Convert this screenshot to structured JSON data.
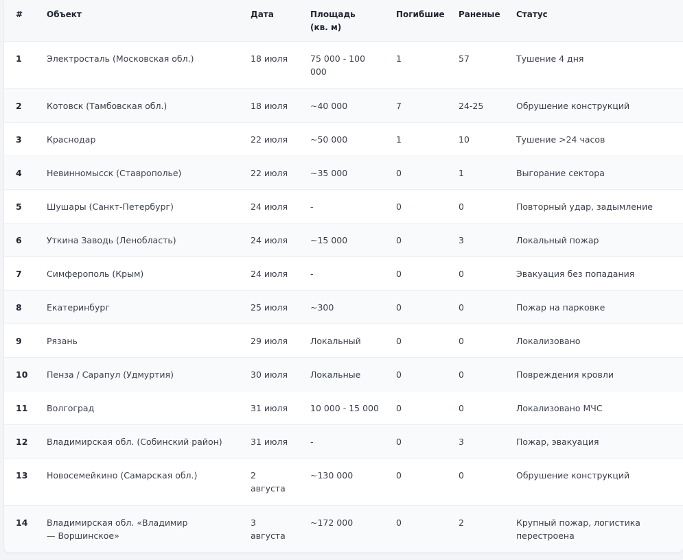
{
  "table": {
    "headers": {
      "num": "#",
      "object": "Объект",
      "date": "Дата",
      "area": "Площадь (кв. м)",
      "dead": "Погибшие",
      "injured": "Раненые",
      "status": "Статус"
    },
    "rows": [
      {
        "num": "1",
        "object": "Электросталь (Московская обл.)",
        "date": "18 июля",
        "area": "75 000 - 100 000",
        "dead": "1",
        "injured": "57",
        "status": "Тушение 4 дня"
      },
      {
        "num": "2",
        "object": "Котовск (Тамбовская обл.)",
        "date": "18 июля",
        "area": "~40 000",
        "dead": "7",
        "injured": "24-25",
        "status": "Обрушение конструкций"
      },
      {
        "num": "3",
        "object": "Краснодар",
        "date": "22 июля",
        "area": "~50 000",
        "dead": "1",
        "injured": "10",
        "status": "Тушение >24 часов"
      },
      {
        "num": "4",
        "object": "Невинномысск (Ставрополье)",
        "date": "22 июля",
        "area": "~35 000",
        "dead": "0",
        "injured": "1",
        "status": "Выгорание сектора"
      },
      {
        "num": "5",
        "object": "Шушары (Санкт-Петербург)",
        "date": "24 июля",
        "area": "-",
        "dead": "0",
        "injured": "0",
        "status": "Повторный удар, задымление"
      },
      {
        "num": "6",
        "object": "Уткина Заводь (Ленобласть)",
        "date": "24 июля",
        "area": "~15 000",
        "dead": "0",
        "injured": "3",
        "status": "Локальный пожар"
      },
      {
        "num": "7",
        "object": "Симферополь (Крым)",
        "date": "24 июля",
        "area": "-",
        "dead": "0",
        "injured": "0",
        "status": "Эвакуация без попадания"
      },
      {
        "num": "8",
        "object": "Екатеринбург",
        "date": "25 июля",
        "area": "~300",
        "dead": "0",
        "injured": "0",
        "status": "Пожар на парковке"
      },
      {
        "num": "9",
        "object": "Рязань",
        "date": "29 июля",
        "area": "Локальный",
        "dead": "0",
        "injured": "0",
        "status": "Локализовано"
      },
      {
        "num": "10",
        "object": "Пенза / Сарапул (Удмуртия)",
        "date": "30 июля",
        "area": "Локальные",
        "dead": "0",
        "injured": "0",
        "status": "Повреждения кровли"
      },
      {
        "num": "11",
        "object": "Волгоград",
        "date": "31 июля",
        "area": "10 000 - 15 000",
        "dead": "0",
        "injured": "0",
        "status": "Локализовано МЧС"
      },
      {
        "num": "12",
        "object": "Владимирская обл. (Собинский район)",
        "date": "31 июля",
        "area": "-",
        "dead": "0",
        "injured": "3",
        "status": "Пожар, эвакуация"
      },
      {
        "num": "13",
        "object": "Новосемейкино (Самарская обл.)",
        "date": "2 августа",
        "area": "~130 000",
        "dead": "0",
        "injured": "0",
        "status": "Обрушение конструкций"
      },
      {
        "num": "14",
        "object": "Владимирская обл. «Владимир — Воршинское»",
        "date": "3 августа",
        "area": "~172 000",
        "dead": "0",
        "injured": "2",
        "status": "Крупный пожар, логистика перестроена"
      }
    ]
  }
}
